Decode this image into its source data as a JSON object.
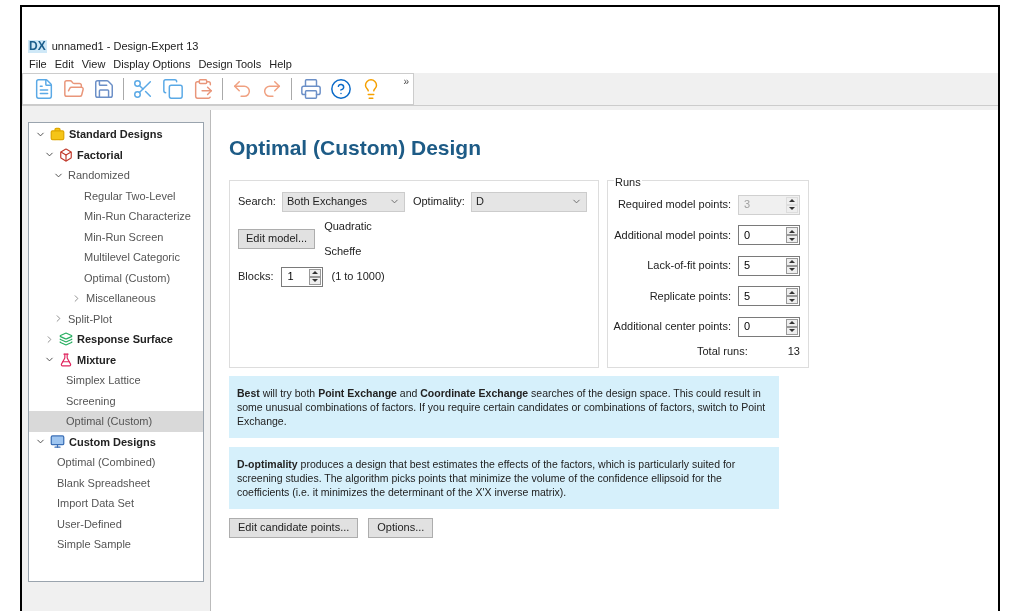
{
  "window": {
    "logo": "DX",
    "title": "unnamed1 - Design-Expert 13"
  },
  "menu": [
    "File",
    "Edit",
    "View",
    "Display Options",
    "Design Tools",
    "Help"
  ],
  "toolbar": {
    "overflow": "»"
  },
  "tree": [
    {
      "label": "Standard Designs",
      "kind": "section",
      "expanded": true,
      "selected": false,
      "children": [
        {
          "label": "Factorial",
          "kind": "category",
          "expanded": true,
          "selected": false,
          "children": [
            {
              "label": "Randomized",
              "kind": "folder",
              "expanded": true,
              "selected": false,
              "children": [
                {
                  "label": "Regular Two-Level",
                  "kind": "design",
                  "selected": false
                },
                {
                  "label": "Min-Run Characterize",
                  "kind": "design",
                  "selected": false
                },
                {
                  "label": "Min-Run Screen",
                  "kind": "design",
                  "selected": false
                },
                {
                  "label": "Multilevel Categoric",
                  "kind": "design",
                  "selected": false
                },
                {
                  "label": "Optimal (Custom)",
                  "kind": "design",
                  "selected": false
                },
                {
                  "label": "Miscellaneous",
                  "kind": "folder",
                  "expanded": false,
                  "selected": false
                }
              ]
            },
            {
              "label": "Split-Plot",
              "kind": "folder",
              "expanded": false,
              "selected": false
            }
          ]
        },
        {
          "label": "Response Surface",
          "kind": "category",
          "expanded": false,
          "selected": false
        },
        {
          "label": "Mixture",
          "kind": "category",
          "expanded": true,
          "selected": false,
          "children": [
            {
              "label": "Simplex Lattice",
              "kind": "design",
              "selected": false
            },
            {
              "label": "Screening",
              "kind": "design",
              "selected": false
            },
            {
              "label": "Optimal (Custom)",
              "kind": "design",
              "selected": true
            }
          ]
        }
      ]
    },
    {
      "label": "Custom Designs",
      "kind": "section",
      "expanded": true,
      "selected": false,
      "children": [
        {
          "label": "Optimal (Combined)",
          "kind": "design",
          "selected": false
        },
        {
          "label": "Blank Spreadsheet",
          "kind": "design",
          "selected": false
        },
        {
          "label": "Import Data Set",
          "kind": "design",
          "selected": false
        },
        {
          "label": "User-Defined",
          "kind": "design",
          "selected": false
        },
        {
          "label": "Simple Sample",
          "kind": "design",
          "selected": false
        }
      ]
    }
  ],
  "page_title": "Optimal (Custom) Design",
  "search": {
    "label": "Search:",
    "value": "Both Exchanges"
  },
  "optimality": {
    "label": "Optimality:",
    "value": "D"
  },
  "edit_model_button": "Edit model...",
  "model": [
    "Quadratic",
    "Scheffe"
  ],
  "blocks": {
    "label": "Blocks:",
    "value": "1",
    "range": "(1 to 1000)"
  },
  "runs": {
    "title": "Runs",
    "fields": [
      {
        "label": "Required model points:",
        "value": "3",
        "disabled": true
      },
      {
        "label": "Additional model points:",
        "value": "0",
        "disabled": false
      },
      {
        "label": "Lack-of-fit points:",
        "value": "5",
        "disabled": false
      },
      {
        "label": "Replicate points:",
        "value": "5",
        "disabled": false
      },
      {
        "label": "Additional center points:",
        "value": "0",
        "disabled": false
      }
    ],
    "total_label": "Total runs:",
    "total": "13"
  },
  "notes": [
    "**Best** will try both **Point Exchange** and **Coordinate Exchange** searches of the design space. This could result in some unusual combinations of factors. If you require certain candidates or combinations of factors, switch to Point Exchange.",
    "**D-optimality** produces a design that best estimates the effects of the factors, which is particularly suited for screening studies. The algorithm picks points that minimize the volume of the confidence ellipsoid for the coefficients (i.e. it minimizes the determinant of the X'X inverse matrix)."
  ],
  "buttons": [
    "Edit candidate points...",
    "Options..."
  ]
}
